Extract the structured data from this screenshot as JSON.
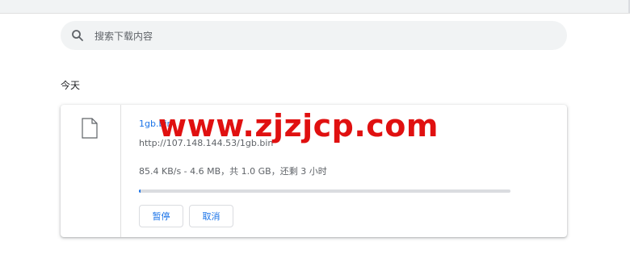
{
  "search": {
    "placeholder": "搜索下载内容",
    "icon": "search-icon"
  },
  "section": {
    "title": "今天"
  },
  "download": {
    "filename": "1gb.bin",
    "url": "http://107.148.144.53/1gb.bin",
    "status": "85.4 KB/s - 4.6 MB，共 1.0 GB，还剩 3 小时",
    "progress_fraction": 0.0046,
    "icon": "file-icon",
    "buttons": {
      "pause": "暂停",
      "cancel": "取消"
    }
  },
  "watermark": {
    "text": "www.zjzjcp.com"
  },
  "colors": {
    "link": "#1a73e8",
    "watermark": "#e01010",
    "search_bg": "#f1f3f4"
  }
}
